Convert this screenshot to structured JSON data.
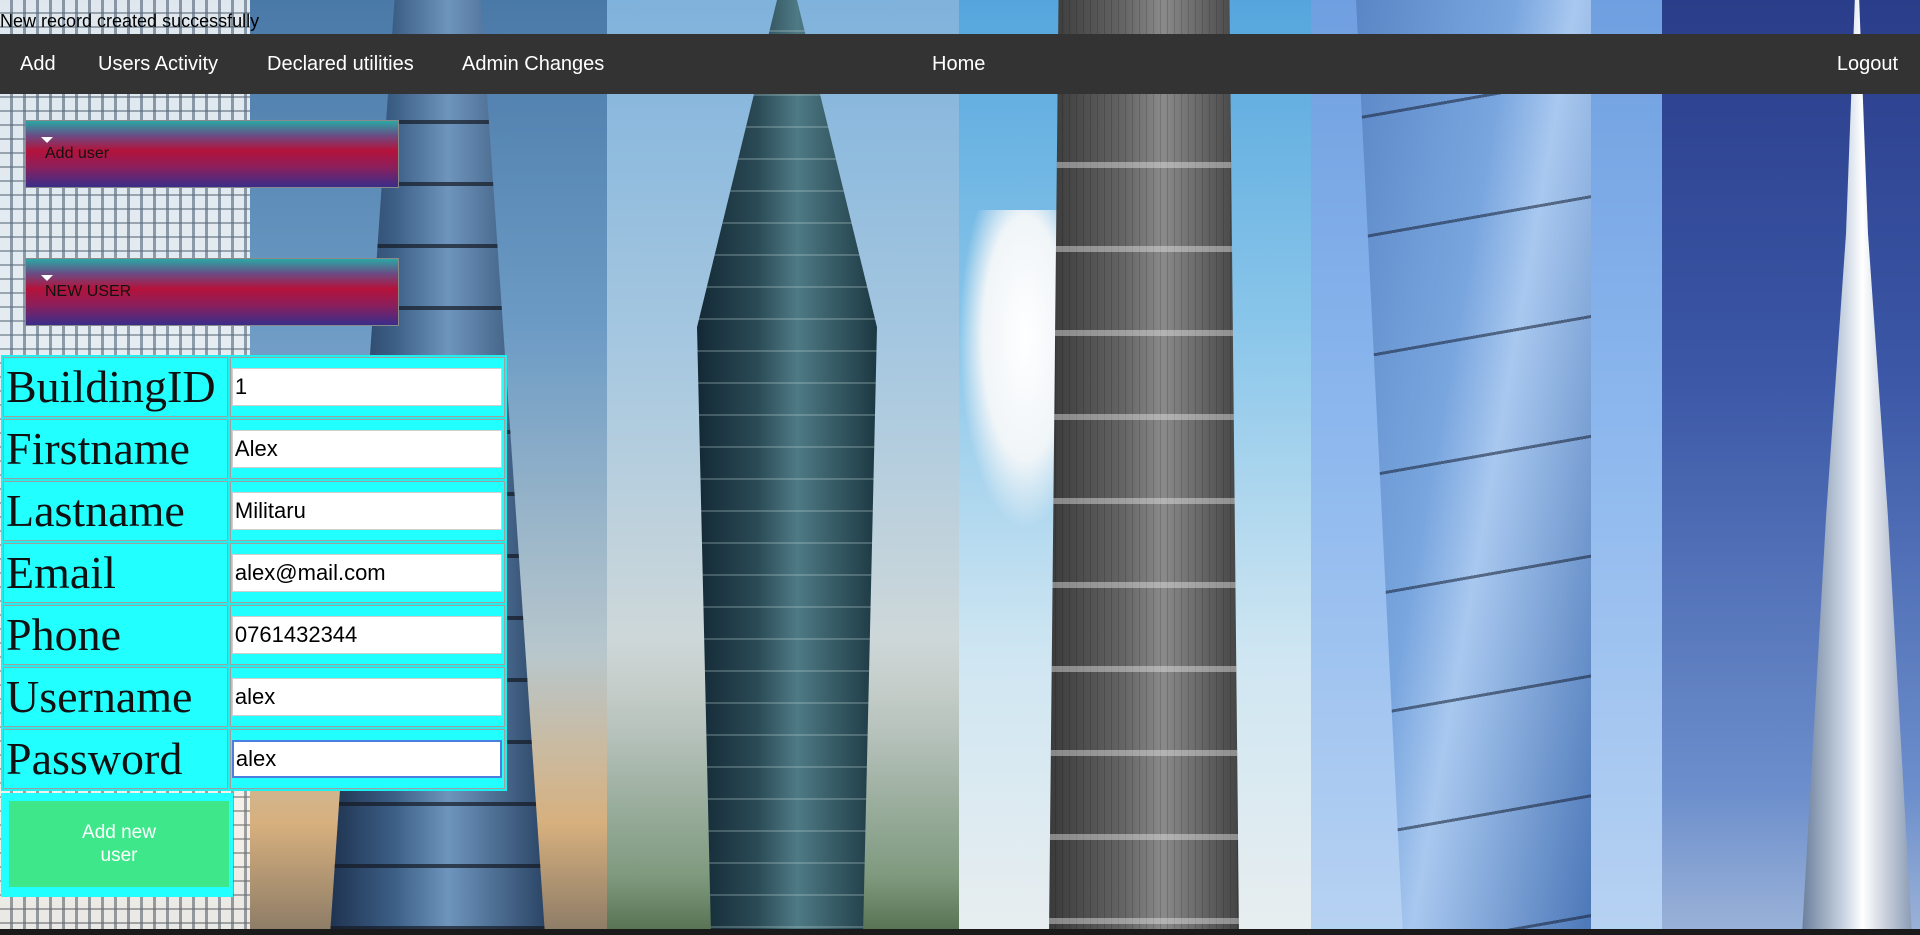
{
  "flash_message": "New record created successfully",
  "nav": {
    "add": "Add",
    "users_activity": "Users Activity",
    "declared_utilities": "Declared utilities",
    "admin_changes": "Admin Changes",
    "home": "Home",
    "logout": "Logout"
  },
  "collapsibles": [
    {
      "label": "Add user"
    },
    {
      "label": "NEW USER"
    }
  ],
  "form": {
    "fields": [
      {
        "label": "BuildingID",
        "value": "1"
      },
      {
        "label": "Firstname",
        "value": "Alex"
      },
      {
        "label": "Lastname",
        "value": "Militaru"
      },
      {
        "label": "Email",
        "value": "alex@mail.com"
      },
      {
        "label": "Phone",
        "value": "0761432344"
      },
      {
        "label": "Username",
        "value": "alex"
      },
      {
        "label": "Password",
        "value": "alex"
      }
    ],
    "submit_label": "Add new user"
  },
  "colors": {
    "navbar": "#333333",
    "form_background": "#22ffff",
    "submit_button": "#3ee88a"
  }
}
